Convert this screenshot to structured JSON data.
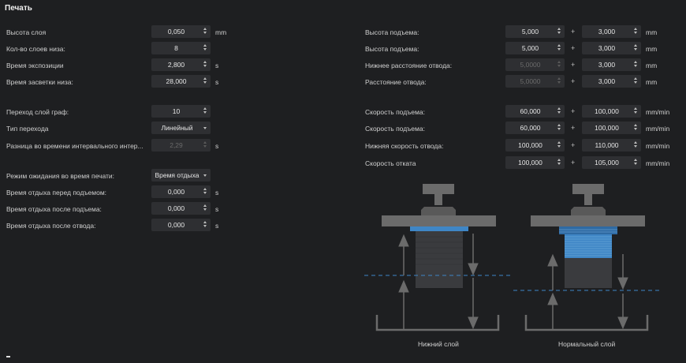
{
  "title": "Печать",
  "left": {
    "layer_height": {
      "label": "Высота слоя",
      "value": "0,050",
      "unit": "mm"
    },
    "bottom_layers": {
      "label": "Кол-во слоев низа:",
      "value": "8"
    },
    "exposure": {
      "label": "Время экспозиции",
      "value": "2,800",
      "unit": "s"
    },
    "bottom_exposure": {
      "label": "Время засветки низа:",
      "value": "28,000",
      "unit": "s"
    },
    "transition_layers": {
      "label": "Переход слой граф:",
      "value": "10"
    },
    "transition_type": {
      "label": "Тип перехода",
      "value": "Линейный"
    },
    "interval_time": {
      "label": "Разница во времени интервального интер...",
      "value": "2,29",
      "unit": "s"
    },
    "wait_mode": {
      "label": "Режим ожидания во время печати:",
      "value": "Время отдыха"
    },
    "rest_before_lift": {
      "label": "Время отдыха перед подъемом:",
      "value": "0,000",
      "unit": "s"
    },
    "rest_after_lift": {
      "label": "Время отдыха после подъема:",
      "value": "0,000",
      "unit": "s"
    },
    "rest_after_retract": {
      "label": "Время отдыха после отвода:",
      "value": "0,000",
      "unit": "s"
    }
  },
  "right": {
    "lift_height_bottom": {
      "label": "Высота подъема:",
      "v1": "5,000",
      "v2": "3,000",
      "unit": "mm"
    },
    "lift_height": {
      "label": "Высота подъема:",
      "v1": "5,000",
      "v2": "3,000",
      "unit": "mm"
    },
    "bottom_retract_dist": {
      "label": "Нижнее расстояние отвода:",
      "v1": "5,0000",
      "v2": "3,000",
      "unit": "mm"
    },
    "retract_dist": {
      "label": "Расстояние отвода:",
      "v1": "5,0000",
      "v2": "3,000",
      "unit": "mm"
    },
    "lift_speed_bottom": {
      "label": "Скорость подъема:",
      "v1": "60,000",
      "v2": "100,000",
      "unit": "mm/min"
    },
    "lift_speed": {
      "label": "Скорость подъема:",
      "v1": "60,000",
      "v2": "100,000",
      "unit": "mm/min"
    },
    "bottom_retract_speed": {
      "label": "Нижняя скорость отвода:",
      "v1": "100,000",
      "v2": "110,000",
      "unit": "mm/min"
    },
    "retract_speed": {
      "label": "Скорость отката",
      "v1": "100,000",
      "v2": "105,000",
      "unit": "mm/min"
    },
    "plus": "+"
  },
  "diagram": {
    "caption_bottom": "Нижний слой",
    "caption_normal": "Нормальный слой",
    "colors": {
      "resin": "#3f86c6",
      "frame": "#6b6b6b",
      "dash": "#3f86c6"
    }
  }
}
